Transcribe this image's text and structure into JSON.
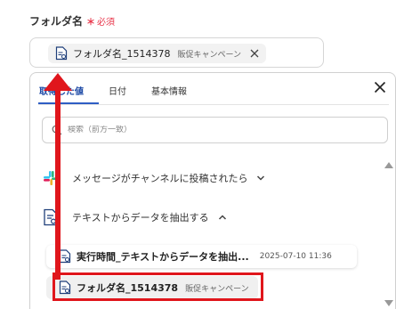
{
  "field": {
    "label": "フォルダ名",
    "required_mark": "＊",
    "required_text": "必須",
    "selected_chip": {
      "name": "フォルダ名_1514378",
      "sub": "販促キャンペーン"
    }
  },
  "panel": {
    "tabs": [
      {
        "label": "取得した値",
        "active": true
      },
      {
        "label": "日付",
        "active": false
      },
      {
        "label": "基本情報",
        "active": false
      }
    ],
    "search_placeholder": "検索（前方一致）",
    "groups": [
      {
        "label": "メッセージがチャンネルに投稿されたら",
        "icon": "slack-icon",
        "expanded": false
      },
      {
        "label": "テキストからデータを抽出する",
        "icon": "document-icon",
        "expanded": true
      }
    ],
    "items": [
      {
        "name": "実行時間_テキストからデータを抽出...",
        "sub": "2025-07-10 11:36"
      },
      {
        "name": "フォルダ名_1514378",
        "sub": "販促キャンペーン"
      }
    ]
  },
  "colors": {
    "accent": "#2f5ec4",
    "required": "#e8354a",
    "annotation": "#e0161c"
  }
}
